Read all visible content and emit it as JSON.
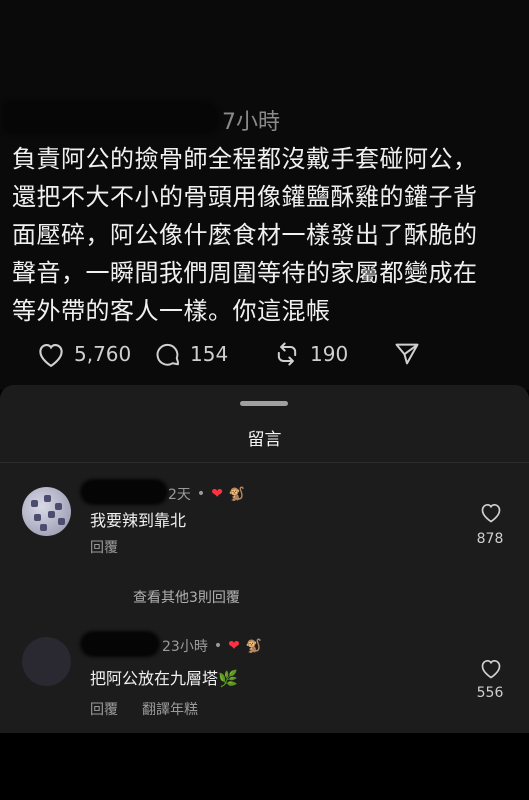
{
  "post": {
    "time": "7小時",
    "lines": [
      "負責阿公的撿骨師全程都沒戴手套碰阿公，",
      "還把不大不小的骨頭用像鑵鹽酥雞的鑵子背",
      "面壓碎，阿公像什麼食材一樣發出了酥脆的",
      "聲音，一瞬間我們周圍等待的家屬都變成在",
      "等外帶的客人一樣。你這混帳"
    ],
    "likes": "5,760",
    "comments": "154",
    "reposts": "190",
    "icons": {
      "like": "heart-icon",
      "comment": "comment-bubble-icon",
      "repost": "repost-icon",
      "share": "send-icon"
    }
  },
  "sheet": {
    "title": "留言",
    "comments": [
      {
        "time": "2天",
        "text": "我要辣到靠北",
        "reply_label": "回覆",
        "likes": "878",
        "more_replies": "查看其他3則回覆"
      },
      {
        "time": "23小時",
        "text": "把阿公放在九層塔🌿",
        "reply_label": "回覆",
        "translate_label": "翻譯年糕",
        "likes": "556"
      }
    ]
  },
  "colors": {
    "background": "#000000",
    "sheet": "#1c1c1c",
    "heart_red": "#ff3040"
  }
}
